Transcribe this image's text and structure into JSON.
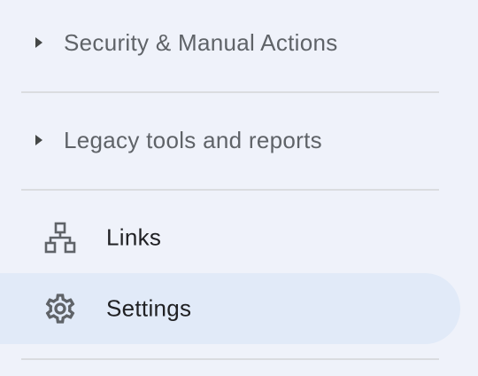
{
  "sidebar": {
    "sections": [
      {
        "label": "Security & Manual Actions",
        "icon": "caret-right-icon"
      },
      {
        "label": "Legacy tools and reports",
        "icon": "caret-right-icon"
      }
    ],
    "items": [
      {
        "label": "Links",
        "icon": "links-tree-icon",
        "selected": false
      },
      {
        "label": "Settings",
        "icon": "gear-icon",
        "selected": true
      }
    ]
  },
  "colors": {
    "background": "#eff2fa",
    "selected_background": "#e1eaf8",
    "section_text": "#5f6368",
    "item_text": "#202124",
    "icon": "#5f6368",
    "divider": "#dadce0"
  }
}
